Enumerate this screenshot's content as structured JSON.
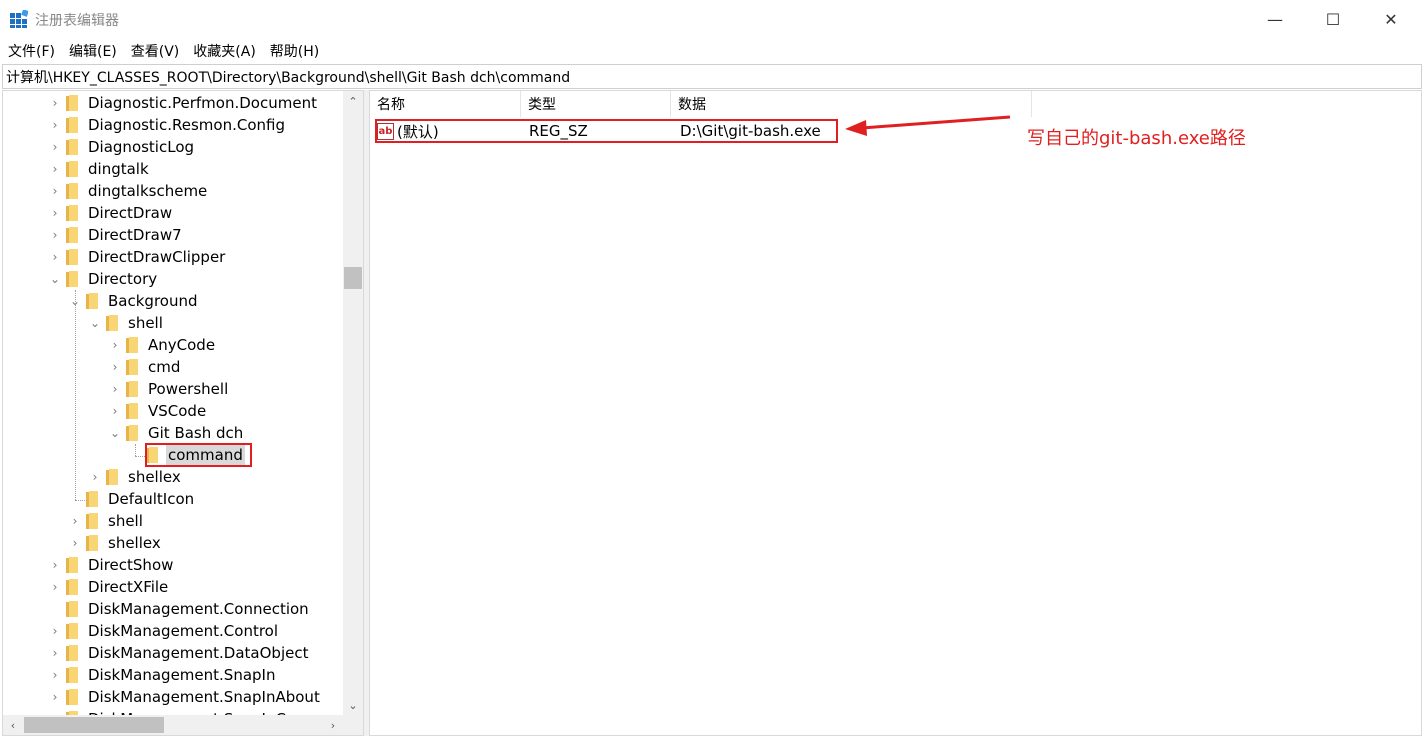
{
  "window": {
    "title": "注册表编辑器",
    "controls": {
      "minimize": "—",
      "maximize": "☐",
      "close": "✕"
    }
  },
  "menu": [
    "文件(F)",
    "编辑(E)",
    "查看(V)",
    "收藏夹(A)",
    "帮助(H)"
  ],
  "address": "计算机\\HKEY_CLASSES_ROOT\\Directory\\Background\\shell\\Git Bash dch\\command",
  "tree": {
    "items": [
      {
        "label": "Diagnostic.Perfmon.Document",
        "arrow": "›"
      },
      {
        "label": "Diagnostic.Resmon.Config",
        "arrow": "›"
      },
      {
        "label": "DiagnosticLog",
        "arrow": "›"
      },
      {
        "label": "dingtalk",
        "arrow": "›"
      },
      {
        "label": "dingtalkscheme",
        "arrow": "›"
      },
      {
        "label": "DirectDraw",
        "arrow": "›"
      },
      {
        "label": "DirectDraw7",
        "arrow": "›"
      },
      {
        "label": "DirectDrawClipper",
        "arrow": "›"
      },
      {
        "label": "Directory",
        "arrow": "⌄"
      },
      {
        "label": "Background",
        "arrow": "⌄"
      },
      {
        "label": "shell",
        "arrow": "⌄"
      },
      {
        "label": "AnyCode",
        "arrow": "›"
      },
      {
        "label": "cmd",
        "arrow": "›"
      },
      {
        "label": "Powershell",
        "arrow": "›"
      },
      {
        "label": "VSCode",
        "arrow": "›"
      },
      {
        "label": "Git Bash dch",
        "arrow": "⌄"
      },
      {
        "label": "command",
        "arrow": ""
      },
      {
        "label": "shellex",
        "arrow": "›"
      },
      {
        "label": "DefaultIcon",
        "arrow": ""
      },
      {
        "label": "shell",
        "arrow": "›"
      },
      {
        "label": "shellex",
        "arrow": "›"
      },
      {
        "label": "DirectShow",
        "arrow": "›"
      },
      {
        "label": "DirectXFile",
        "arrow": "›"
      },
      {
        "label": "DiskManagement.Connection",
        "arrow": ""
      },
      {
        "label": "DiskManagement.Control",
        "arrow": "›"
      },
      {
        "label": "DiskManagement.DataObject",
        "arrow": "›"
      },
      {
        "label": "DiskManagement.SnapIn",
        "arrow": "›"
      },
      {
        "label": "DiskManagement.SnapInAbout",
        "arrow": "›"
      },
      {
        "label": "DiskManagement.SnapInC",
        "arrow": "›"
      }
    ],
    "selected": "command"
  },
  "list": {
    "columns": {
      "name": "名称",
      "type": "类型",
      "data": "数据"
    },
    "rows": [
      {
        "icon": "ab",
        "name": "(默认)",
        "type": "REG_SZ",
        "data": "D:\\Git\\git-bash.exe"
      }
    ]
  },
  "annotation": {
    "text": "写自己的git-bash.exe路径",
    "color": "#e02020"
  },
  "scroll": {
    "up": "⌃",
    "down": "⌄",
    "left": "‹",
    "right": "›"
  }
}
